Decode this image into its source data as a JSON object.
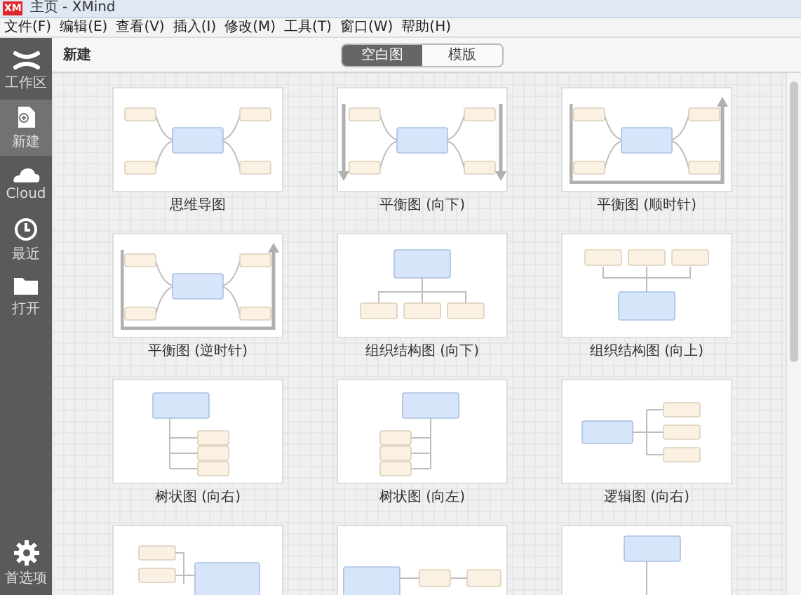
{
  "window": {
    "logo_text": "XM",
    "title": "主页 - XMind"
  },
  "menu": [
    "文件(F)",
    "编辑(E)",
    "查看(V)",
    "插入(I)",
    "修改(M)",
    "工具(T)",
    "窗口(W)",
    "帮助(H)"
  ],
  "sidebar": {
    "items": [
      {
        "kind": "cross",
        "label": "工作区",
        "selected": false
      },
      {
        "kind": "new",
        "label": "新建",
        "selected": true
      },
      {
        "kind": "cloud",
        "label": "Cloud",
        "selected": false
      },
      {
        "kind": "clock",
        "label": "最近",
        "selected": false
      },
      {
        "kind": "folder",
        "label": "打开",
        "selected": false
      }
    ],
    "bottom": {
      "kind": "gear",
      "label": "首选项"
    }
  },
  "header": {
    "title": "新建",
    "tabs": [
      {
        "label": "空白图",
        "selected": true
      },
      {
        "label": "模版",
        "selected": false
      }
    ]
  },
  "templates": [
    {
      "kind": "mindmap",
      "label": "思维导图"
    },
    {
      "kind": "balance-down",
      "label": "平衡图 (向下)"
    },
    {
      "kind": "balance-cw",
      "label": "平衡图 (顺时针)"
    },
    {
      "kind": "balance-ccw",
      "label": "平衡图 (逆时针)"
    },
    {
      "kind": "org-down",
      "label": "组织结构图 (向下)"
    },
    {
      "kind": "org-up",
      "label": "组织结构图 (向上)"
    },
    {
      "kind": "tree-right",
      "label": "树状图 (向右)"
    },
    {
      "kind": "tree-left",
      "label": "树状图 (向左)"
    },
    {
      "kind": "logic-right",
      "label": "逻辑图 (向右)"
    },
    {
      "kind": "logic-left"
    },
    {
      "kind": "timeline"
    },
    {
      "kind": "tree-down"
    }
  ]
}
